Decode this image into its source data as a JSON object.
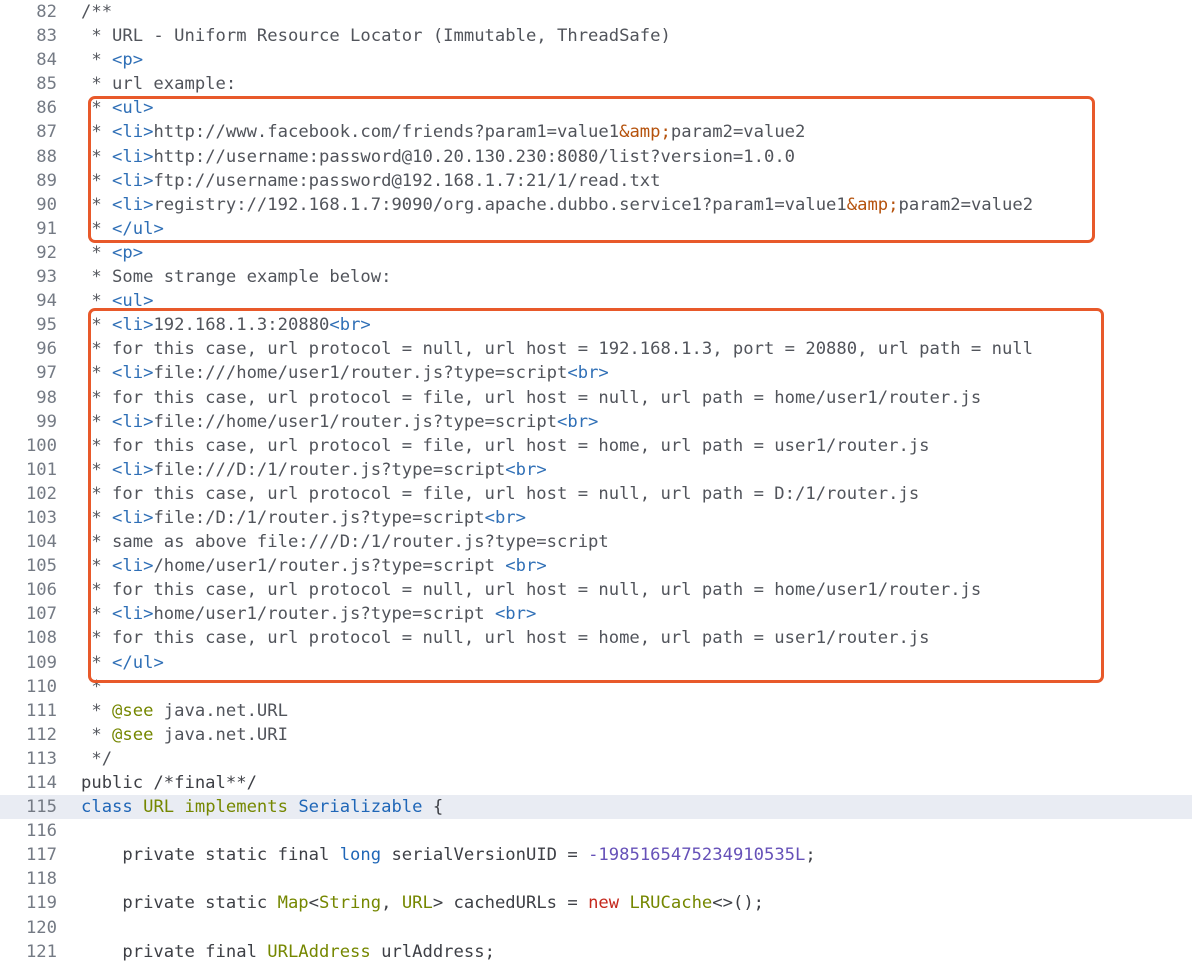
{
  "editor": {
    "current_line": "115",
    "highlight_color": "#e8592a",
    "lines": [
      {
        "num": "82",
        "segments": [
          {
            "c": "c",
            "t": "/**"
          }
        ]
      },
      {
        "num": "83",
        "segments": [
          {
            "c": "c",
            "t": " * URL - Uniform Resource Locator (Immutable, ThreadSafe)"
          }
        ]
      },
      {
        "num": "84",
        "segments": [
          {
            "c": "c",
            "t": " * "
          },
          {
            "c": "t",
            "t": "<p>"
          }
        ]
      },
      {
        "num": "85",
        "segments": [
          {
            "c": "c",
            "t": " * url example:"
          }
        ]
      },
      {
        "num": "86",
        "segments": [
          {
            "c": "c",
            "t": " * "
          },
          {
            "c": "t",
            "t": "<ul>"
          }
        ]
      },
      {
        "num": "87",
        "segments": [
          {
            "c": "c",
            "t": " * "
          },
          {
            "c": "t",
            "t": "<li>"
          },
          {
            "c": "c",
            "t": "http://www.facebook.com/friends?param1=value1"
          },
          {
            "c": "en",
            "t": "&amp;"
          },
          {
            "c": "c",
            "t": "param2=value2"
          }
        ]
      },
      {
        "num": "88",
        "segments": [
          {
            "c": "c",
            "t": " * "
          },
          {
            "c": "t",
            "t": "<li>"
          },
          {
            "c": "c",
            "t": "http://username:password@10.20.130.230:8080/list?version=1.0.0"
          }
        ]
      },
      {
        "num": "89",
        "segments": [
          {
            "c": "c",
            "t": " * "
          },
          {
            "c": "t",
            "t": "<li>"
          },
          {
            "c": "c",
            "t": "ftp://username:password@192.168.1.7:21/1/read.txt"
          }
        ]
      },
      {
        "num": "90",
        "segments": [
          {
            "c": "c",
            "t": " * "
          },
          {
            "c": "t",
            "t": "<li>"
          },
          {
            "c": "c",
            "t": "registry://192.168.1.7:9090/org.apache.dubbo.service1?param1=value1"
          },
          {
            "c": "en",
            "t": "&amp;"
          },
          {
            "c": "c",
            "t": "param2=value2"
          }
        ]
      },
      {
        "num": "91",
        "segments": [
          {
            "c": "c",
            "t": " * "
          },
          {
            "c": "t",
            "t": "</ul>"
          }
        ]
      },
      {
        "num": "92",
        "segments": [
          {
            "c": "c",
            "t": " * "
          },
          {
            "c": "t",
            "t": "<p>"
          }
        ]
      },
      {
        "num": "93",
        "segments": [
          {
            "c": "c",
            "t": " * Some strange example below:"
          }
        ]
      },
      {
        "num": "94",
        "segments": [
          {
            "c": "c",
            "t": " * "
          },
          {
            "c": "t",
            "t": "<ul>"
          }
        ]
      },
      {
        "num": "95",
        "segments": [
          {
            "c": "c",
            "t": " * "
          },
          {
            "c": "t",
            "t": "<li>"
          },
          {
            "c": "c",
            "t": "192.168.1.3:20880"
          },
          {
            "c": "t",
            "t": "<br>"
          }
        ]
      },
      {
        "num": "96",
        "segments": [
          {
            "c": "c",
            "t": " * for this case, url protocol = null, url host = 192.168.1.3, port = 20880, url path = null"
          }
        ]
      },
      {
        "num": "97",
        "segments": [
          {
            "c": "c",
            "t": " * "
          },
          {
            "c": "t",
            "t": "<li>"
          },
          {
            "c": "c",
            "t": "file:///home/user1/router.js?type=script"
          },
          {
            "c": "t",
            "t": "<br>"
          }
        ]
      },
      {
        "num": "98",
        "segments": [
          {
            "c": "c",
            "t": " * for this case, url protocol = file, url host = null, url path = home/user1/router.js"
          }
        ]
      },
      {
        "num": "99",
        "segments": [
          {
            "c": "c",
            "t": " * "
          },
          {
            "c": "t",
            "t": "<li>"
          },
          {
            "c": "c",
            "t": "file://home/user1/router.js?type=script"
          },
          {
            "c": "t",
            "t": "<br>"
          }
        ]
      },
      {
        "num": "100",
        "segments": [
          {
            "c": "c",
            "t": " * for this case, url protocol = file, url host = home, url path = user1/router.js"
          }
        ]
      },
      {
        "num": "101",
        "segments": [
          {
            "c": "c",
            "t": " * "
          },
          {
            "c": "t",
            "t": "<li>"
          },
          {
            "c": "c",
            "t": "file:///D:/1/router.js?type=script"
          },
          {
            "c": "t",
            "t": "<br>"
          }
        ]
      },
      {
        "num": "102",
        "segments": [
          {
            "c": "c",
            "t": " * for this case, url protocol = file, url host = null, url path = D:/1/router.js"
          }
        ]
      },
      {
        "num": "103",
        "segments": [
          {
            "c": "c",
            "t": " * "
          },
          {
            "c": "t",
            "t": "<li>"
          },
          {
            "c": "c",
            "t": "file:/D:/1/router.js?type=script"
          },
          {
            "c": "t",
            "t": "<br>"
          }
        ]
      },
      {
        "num": "104",
        "segments": [
          {
            "c": "c",
            "t": " * same as above file:///D:/1/router.js?type=script"
          }
        ]
      },
      {
        "num": "105",
        "segments": [
          {
            "c": "c",
            "t": " * "
          },
          {
            "c": "t",
            "t": "<li>"
          },
          {
            "c": "c",
            "t": "/home/user1/router.js?type=script "
          },
          {
            "c": "t",
            "t": "<br>"
          }
        ]
      },
      {
        "num": "106",
        "segments": [
          {
            "c": "c",
            "t": " * for this case, url protocol = null, url host = null, url path = home/user1/router.js"
          }
        ]
      },
      {
        "num": "107",
        "segments": [
          {
            "c": "c",
            "t": " * "
          },
          {
            "c": "t",
            "t": "<li>"
          },
          {
            "c": "c",
            "t": "home/user1/router.js?type=script "
          },
          {
            "c": "t",
            "t": "<br>"
          }
        ]
      },
      {
        "num": "108",
        "segments": [
          {
            "c": "c",
            "t": " * for this case, url protocol = null, url host = home, url path = user1/router.js"
          }
        ]
      },
      {
        "num": "109",
        "segments": [
          {
            "c": "c",
            "t": " * "
          },
          {
            "c": "t",
            "t": "</ul>"
          }
        ]
      },
      {
        "num": "110",
        "segments": [
          {
            "c": "c",
            "t": " *"
          }
        ]
      },
      {
        "num": "111",
        "segments": [
          {
            "c": "c",
            "t": " * "
          },
          {
            "c": "an",
            "t": "@see"
          },
          {
            "c": "c",
            "t": " java.net.URL"
          }
        ]
      },
      {
        "num": "112",
        "segments": [
          {
            "c": "c",
            "t": " * "
          },
          {
            "c": "an",
            "t": "@see"
          },
          {
            "c": "c",
            "t": " java.net.URI"
          }
        ]
      },
      {
        "num": "113",
        "segments": [
          {
            "c": "c",
            "t": " */"
          }
        ]
      },
      {
        "num": "114",
        "segments": [
          {
            "c": "op",
            "t": "public /*final**/"
          }
        ]
      },
      {
        "num": "115",
        "segments": [
          {
            "c": "kw",
            "t": "class "
          },
          {
            "c": "ty",
            "t": "URL "
          },
          {
            "c": "ty",
            "t": "implements "
          },
          {
            "c": "kw",
            "t": "Serializable"
          },
          {
            "c": "op",
            "t": " {"
          }
        ]
      },
      {
        "num": "116",
        "segments": []
      },
      {
        "num": "117",
        "segments": [
          {
            "c": "op",
            "t": "    private static final "
          },
          {
            "c": "kw",
            "t": "long"
          },
          {
            "c": "op",
            "t": " serialVersionUID = "
          },
          {
            "c": "nm",
            "t": "-1985165475234910535L"
          },
          {
            "c": "op",
            "t": ";"
          }
        ]
      },
      {
        "num": "118",
        "segments": []
      },
      {
        "num": "119",
        "segments": [
          {
            "c": "op",
            "t": "    private static "
          },
          {
            "c": "ty",
            "t": "Map"
          },
          {
            "c": "op",
            "t": "<"
          },
          {
            "c": "ty",
            "t": "String"
          },
          {
            "c": "op",
            "t": ", "
          },
          {
            "c": "ty",
            "t": "URL"
          },
          {
            "c": "op",
            "t": "> cachedURLs = "
          },
          {
            "c": "nw",
            "t": "new "
          },
          {
            "c": "ty",
            "t": "LRUCache"
          },
          {
            "c": "op",
            "t": "<>();"
          }
        ]
      },
      {
        "num": "120",
        "segments": []
      },
      {
        "num": "121",
        "segments": [
          {
            "c": "op",
            "t": "    private final "
          },
          {
            "c": "ty",
            "t": "URLAddress"
          },
          {
            "c": "op",
            "t": " urlAddress;"
          }
        ]
      }
    ]
  }
}
